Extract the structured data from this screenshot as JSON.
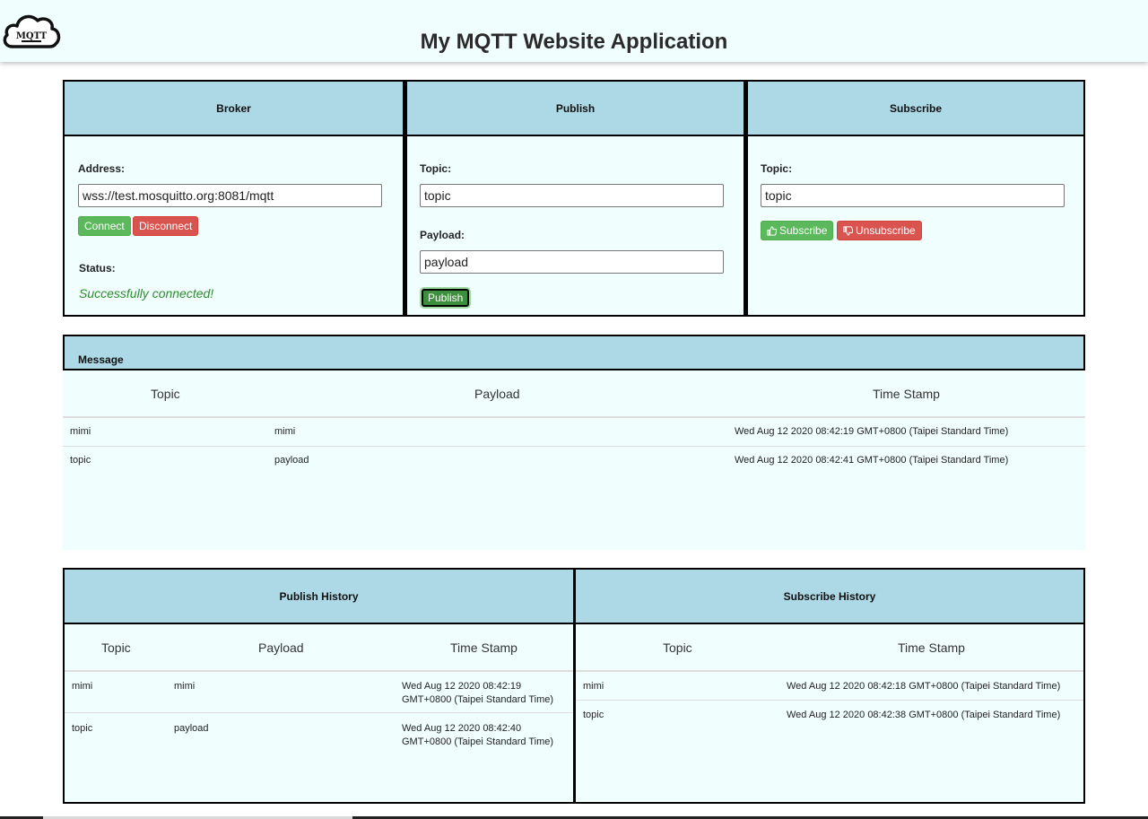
{
  "header": {
    "title": "My MQTT Website Application",
    "logo_text": "MQTT"
  },
  "broker": {
    "heading": "Broker",
    "address_label": "Address:",
    "address_value": "wss://test.mosquitto.org:8081/mqtt",
    "connect_label": "Connect",
    "disconnect_label": "Disconnect",
    "status_label": "Status:",
    "status_value": "Successfully connected!"
  },
  "publish": {
    "heading": "Publish",
    "topic_label": "Topic:",
    "topic_value": "topic",
    "payload_label": "Payload:",
    "payload_value": "payload",
    "publish_label": "Publish"
  },
  "subscribe": {
    "heading": "Subscribe",
    "topic_label": "Topic:",
    "topic_value": "topic",
    "subscribe_label": "Subscribe",
    "unsubscribe_label": "Unsubscribe",
    "subscribe_icon": "thumbs-up-icon",
    "unsubscribe_icon": "thumbs-down-icon"
  },
  "messages": {
    "heading": "Message",
    "columns": [
      "Topic",
      "Payload",
      "Time Stamp"
    ],
    "rows": [
      {
        "topic": "mimi",
        "payload": "mimi",
        "time": "Wed Aug 12 2020 08:42:19 GMT+0800 (Taipei Standard Time)"
      },
      {
        "topic": "topic",
        "payload": "payload",
        "time": "Wed Aug 12 2020 08:42:41 GMT+0800 (Taipei Standard Time)"
      }
    ]
  },
  "publish_history": {
    "heading": "Publish History",
    "columns": [
      "Topic",
      "Payload",
      "Time Stamp"
    ],
    "rows": [
      {
        "topic": "mimi",
        "payload": "mimi",
        "time_line1": "Wed Aug 12 2020 08:42:19",
        "time_line2": "GMT+0800 (Taipei Standard Time)"
      },
      {
        "topic": "topic",
        "payload": "payload",
        "time_line1": "Wed Aug 12 2020 08:42:40",
        "time_line2": "GMT+0800 (Taipei Standard Time)"
      }
    ]
  },
  "subscribe_history": {
    "heading": "Subscribe History",
    "columns": [
      "Topic",
      "Time Stamp"
    ],
    "rows": [
      {
        "topic": "mimi",
        "time": "Wed Aug 12 2020 08:42:18 GMT+0800 (Taipei Standard Time)"
      },
      {
        "topic": "topic",
        "time": "Wed Aug 12 2020 08:42:38 GMT+0800 (Taipei Standard Time)"
      }
    ]
  },
  "colors": {
    "panel_header": "#add8e6",
    "panel_body": "#f0fffe",
    "success": "#5cb85c",
    "danger": "#d9534f",
    "status_text": "#2e8b2e"
  }
}
